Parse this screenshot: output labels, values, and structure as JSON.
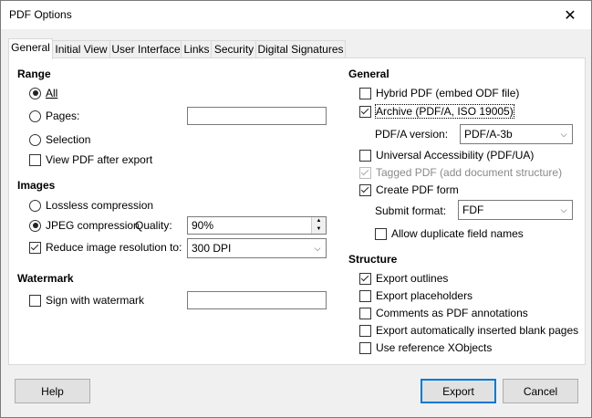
{
  "window": {
    "title": "PDF Options",
    "close_label": "✕"
  },
  "tabs": [
    {
      "label": "General",
      "active": true
    },
    {
      "label": "Initial View"
    },
    {
      "label": "User Interface"
    },
    {
      "label": "Links"
    },
    {
      "label": "Security"
    },
    {
      "label": "Digital Signatures"
    }
  ],
  "range": {
    "heading": "Range",
    "all_label": "All",
    "pages_label": "Pages:",
    "pages_value": "",
    "selection_label": "Selection",
    "view_pdf_label": "View PDF after export"
  },
  "images": {
    "heading": "Images",
    "lossless_label": "Lossless compression",
    "jpeg_label": "JPEG compression",
    "quality_label": "Quality:",
    "quality_value": "90%",
    "reduce_label": "Reduce image resolution to:",
    "resolution_value": "300 DPI"
  },
  "watermark": {
    "heading": "Watermark",
    "sign_label": "Sign with watermark",
    "watermark_value": ""
  },
  "general": {
    "heading": "General",
    "hybrid_label": "Hybrid PDF (embed ODF file)",
    "archive_label": "Archive (PDF/A, ISO 19005)",
    "pdfa_version_label": "PDF/A version:",
    "pdfa_version_value": "PDF/A-3b",
    "ua_label": "Universal Accessibility (PDF/UA)",
    "tagged_label": "Tagged PDF (add document structure)",
    "create_form_label": "Create PDF form",
    "submit_format_label": "Submit format:",
    "submit_format_value": "FDF",
    "allow_dup_label": "Allow duplicate field names"
  },
  "structure": {
    "heading": "Structure",
    "outlines_label": "Export outlines",
    "placeholders_label": "Export placeholders",
    "comments_label": "Comments as PDF annotations",
    "blank_pages_label": "Export automatically inserted blank pages",
    "xobjects_label": "Use reference XObjects"
  },
  "buttons": {
    "help": "Help",
    "export": "Export",
    "cancel": "Cancel"
  }
}
